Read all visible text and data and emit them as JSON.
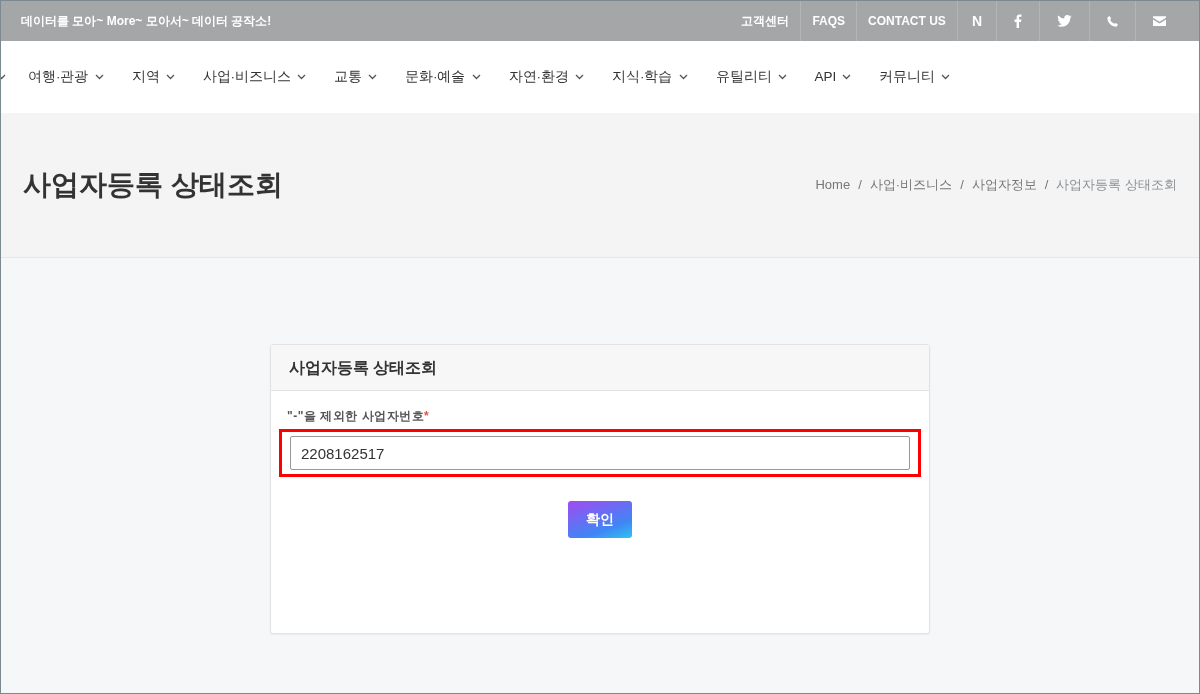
{
  "top_bar": {
    "slogan": "데이터를 모아~ More~ 모아서~ 데이터 공작소!",
    "links": [
      {
        "kind": "text",
        "label": "고객센터"
      },
      {
        "kind": "text",
        "label": "FAQS"
      },
      {
        "kind": "text",
        "label": "CONTACT US"
      },
      {
        "kind": "text",
        "label": "N"
      },
      {
        "kind": "facebook"
      },
      {
        "kind": "twitter"
      },
      {
        "kind": "phone"
      },
      {
        "kind": "mail"
      }
    ]
  },
  "nav": {
    "items": [
      {
        "label": "여행·관광"
      },
      {
        "label": "지역"
      },
      {
        "label": "사업·비즈니스"
      },
      {
        "label": "교통"
      },
      {
        "label": "문화·예술"
      },
      {
        "label": "자연·환경"
      },
      {
        "label": "지식·학습"
      },
      {
        "label": "유틸리티"
      },
      {
        "label": "API"
      },
      {
        "label": "커뮤니티"
      }
    ]
  },
  "page_header": {
    "title": "사업자등록 상태조회",
    "breadcrumb_separator": "/",
    "breadcrumb": [
      {
        "label": "Home",
        "active": false
      },
      {
        "label": "사업·비즈니스",
        "active": false
      },
      {
        "label": "사업자정보",
        "active": false
      },
      {
        "label": "사업자등록 상태조회",
        "active": true
      }
    ]
  },
  "form_card": {
    "title": "사업자등록 상태조회",
    "field": {
      "label": "\"-\"을 제외한 사업자번호",
      "required_mark": "*",
      "value": "2208162517",
      "highlighted": true
    },
    "submit": "확인"
  }
}
